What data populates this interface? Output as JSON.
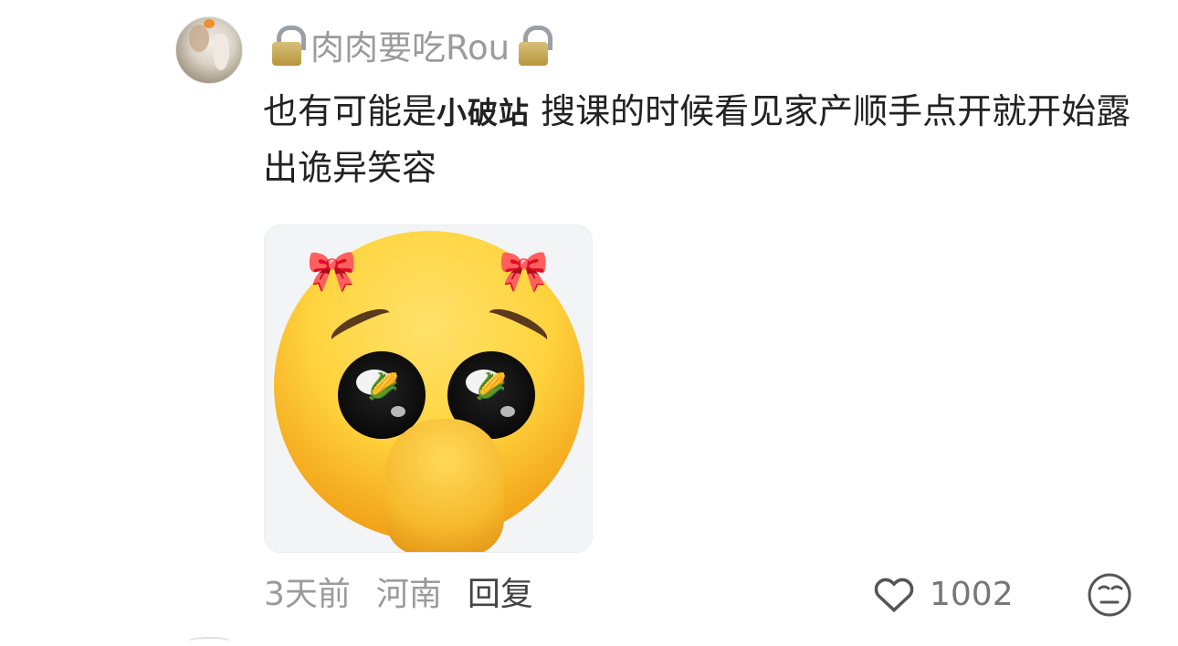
{
  "comment": {
    "username": "肉肉要吃Rou",
    "text_part1": "也有可能是",
    "text_highlight": "小破站",
    "text_part2": " 搜课的时候看见家产顺手点开就开始露出诡异笑容",
    "sticker_icon": "shy-peeking-emoji-sticker",
    "timestamp": "3天前",
    "location": "河南",
    "reply_label": "回复",
    "like_count": "1002",
    "icons": {
      "lock": "lock-icon",
      "like": "heart-outline-icon",
      "react": "emoji-react-icon"
    }
  }
}
